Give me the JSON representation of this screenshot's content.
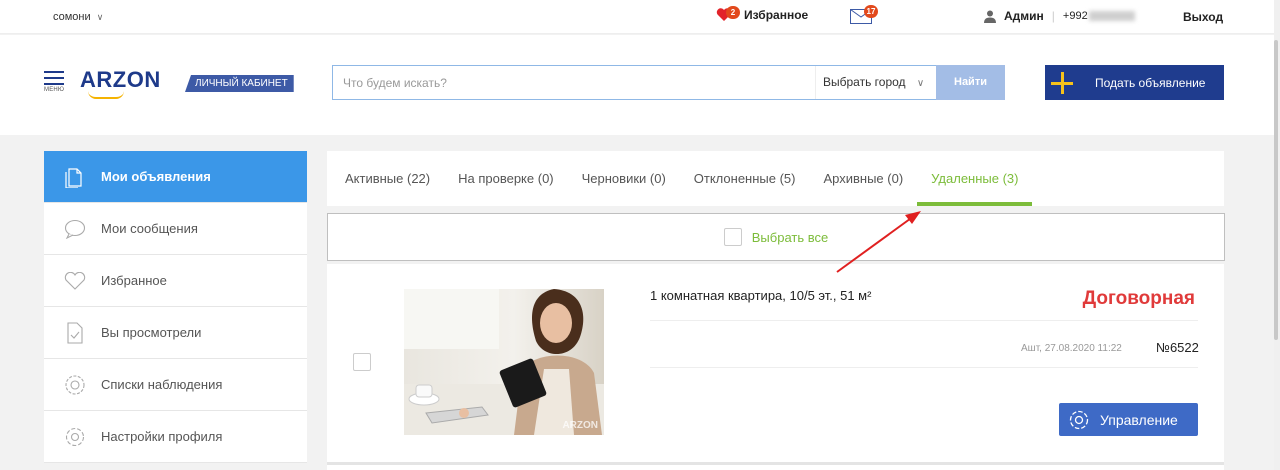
{
  "topbar": {
    "currency": "сомони",
    "favorites_label": "Избранное",
    "favorites_count": "2",
    "messages_count": "17",
    "user_name": "Админ",
    "phone_prefix": "+992",
    "logout_label": "Выход"
  },
  "header": {
    "menu_caption": "МЕНЮ",
    "logo_text": "ARZON",
    "cabinet_label": "ЛИЧНЫЙ КАБИНЕТ",
    "search_placeholder": "Что будем искать?",
    "city_label": "Выбрать город",
    "find_label": "Найти",
    "post_ad_label": "Подать объявление"
  },
  "sidebar": {
    "items": [
      {
        "label": "Мои объявления",
        "icon": "document-icon",
        "active": true
      },
      {
        "label": "Мои сообщения",
        "icon": "chat-bubble-icon"
      },
      {
        "label": "Избранное",
        "icon": "heart-icon"
      },
      {
        "label": "Вы просмотрели",
        "icon": "checked-file-icon"
      },
      {
        "label": "Списки наблюдения",
        "icon": "watch-icon"
      },
      {
        "label": "Настройки профиля",
        "icon": "settings-icon"
      }
    ]
  },
  "tabs": [
    {
      "label": "Активные (22)"
    },
    {
      "label": "На проверке (0)"
    },
    {
      "label": "Черновики (0)"
    },
    {
      "label": "Отклоненные (5)"
    },
    {
      "label": "Архивные (0)"
    },
    {
      "label": "Удаленные (3)",
      "active": true
    }
  ],
  "select_all_label": "Выбрать все",
  "listing": {
    "title": "1 комнатная квартира, 10/5 эт., 51 м²",
    "price": "Договорная",
    "location": "Ашт,",
    "date": "27.08.2020 11:22",
    "number": "№6522",
    "manage_label": "Управление",
    "watermark": "ARZON"
  },
  "colors": {
    "accent_green": "#7cbc3a",
    "brand_blue": "#1f3c8e",
    "sidebar_active": "#3b97e8",
    "price_red": "#e03a3a",
    "arrow_red": "#e02020"
  }
}
